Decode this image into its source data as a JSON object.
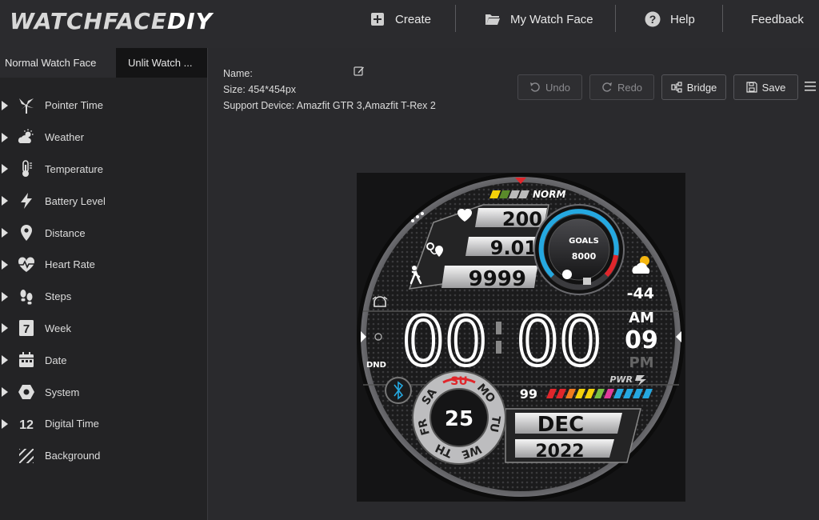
{
  "app": {
    "logo_text": "WATCHFACE",
    "logo_accent": "DIY"
  },
  "nav": {
    "create": "Create",
    "my_watch_face": "My Watch Face",
    "help": "Help",
    "feedback": "Feedback"
  },
  "tabs": [
    {
      "label": "Normal Watch Face"
    },
    {
      "label": "Unlit Watch ..."
    }
  ],
  "menu": [
    {
      "label": "Pointer Time",
      "icon": "pinwheel-icon"
    },
    {
      "label": "Weather",
      "icon": "weather-icon"
    },
    {
      "label": "Temperature",
      "icon": "thermometer-icon"
    },
    {
      "label": "Battery Level",
      "icon": "lightning-icon"
    },
    {
      "label": "Distance",
      "icon": "location-pin-icon"
    },
    {
      "label": "Heart Rate",
      "icon": "heart-rate-icon"
    },
    {
      "label": "Steps",
      "icon": "footprints-icon"
    },
    {
      "label": "Week",
      "icon": "week-icon",
      "glyph": "7"
    },
    {
      "label": "Date",
      "icon": "calendar-icon"
    },
    {
      "label": "System",
      "icon": "system-icon"
    },
    {
      "label": "Digital Time",
      "icon": "digital-time-icon",
      "glyph": "12"
    },
    {
      "label": "Background",
      "icon": "background-icon"
    }
  ],
  "info": {
    "name_label": "Name:",
    "size_label": "Size:",
    "size_value": "454*454px",
    "support_label": "Support Device:",
    "support_value": "Amazfit GTR 3,Amazfit T-Rex 2"
  },
  "toolbar": {
    "undo": "Undo",
    "redo": "Redo",
    "bridge": "Bridge",
    "save": "Save"
  },
  "watch": {
    "mode": "NORM",
    "heart_rate": "200",
    "distance": "9.01",
    "steps": "9999",
    "goals_label": "GOALS",
    "goals_value": "8000",
    "temperature": "-44",
    "hours": "00",
    "minutes": "00",
    "am": "AM",
    "seconds": "09",
    "pm": "PM",
    "dnd": "DND",
    "pwr": "PWR",
    "battery": "99",
    "day": "25",
    "weekdays": [
      "SU",
      "MO",
      "TU",
      "WE",
      "TH",
      "FR",
      "SA"
    ],
    "month": "DEC",
    "year": "2022",
    "colors": {
      "accent_red": "#e0262b",
      "ring_blue": "#25a8e0"
    }
  }
}
